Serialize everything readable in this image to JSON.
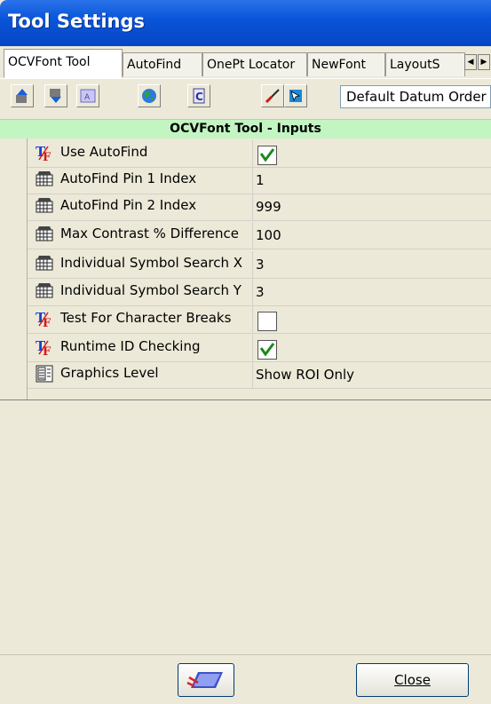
{
  "window": {
    "title": "Tool Settings"
  },
  "tabs": [
    {
      "label": "OCVFont Tool"
    },
    {
      "label": "AutoFind"
    },
    {
      "label": "OnePt Locator"
    },
    {
      "label": "NewFont"
    },
    {
      "label": "LayoutS"
    }
  ],
  "toolbar": {
    "datum_select": "Default Datum Order",
    "icons": [
      "move-up-icon",
      "move-down-icon",
      "text-field-icon",
      "globe-icon",
      "script-icon",
      "brush-icon",
      "pointer-icon"
    ]
  },
  "section_header": "OCVFont Tool - Inputs",
  "rows": [
    {
      "label": "Use AutoFind",
      "value": "",
      "type": "checkbox",
      "checked": true,
      "icon": "tf-icon"
    },
    {
      "label": "AutoFind Pin 1 Index",
      "value": "1",
      "type": "number",
      "icon": "keypad-icon"
    },
    {
      "label": "AutoFind Pin 2 Index",
      "value": "999",
      "type": "number",
      "icon": "keypad-icon"
    },
    {
      "label": "Max Contrast % Difference",
      "value": "100",
      "type": "number",
      "icon": "keypad-icon"
    },
    {
      "label": "Individual Symbol Search X",
      "value": "3",
      "type": "number",
      "icon": "keypad-icon"
    },
    {
      "label": "Individual Symbol Search Y",
      "value": "3",
      "type": "number",
      "icon": "keypad-icon"
    },
    {
      "label": "Test For Character Breaks",
      "value": "",
      "type": "checkbox",
      "checked": false,
      "icon": "tf-icon"
    },
    {
      "label": "Runtime ID Checking",
      "value": "",
      "type": "checkbox",
      "checked": true,
      "icon": "tf-icon"
    },
    {
      "label": "Graphics Level",
      "value": "Show ROI Only",
      "type": "list",
      "icon": "list-icon"
    }
  ],
  "footer": {
    "keyboard_icon": "keyboard-icon",
    "close_label": "Close"
  },
  "colors": {
    "titlebar": "#0a55d9",
    "header_bg": "#c2f5c2",
    "check_color": "#1a8a1a"
  }
}
